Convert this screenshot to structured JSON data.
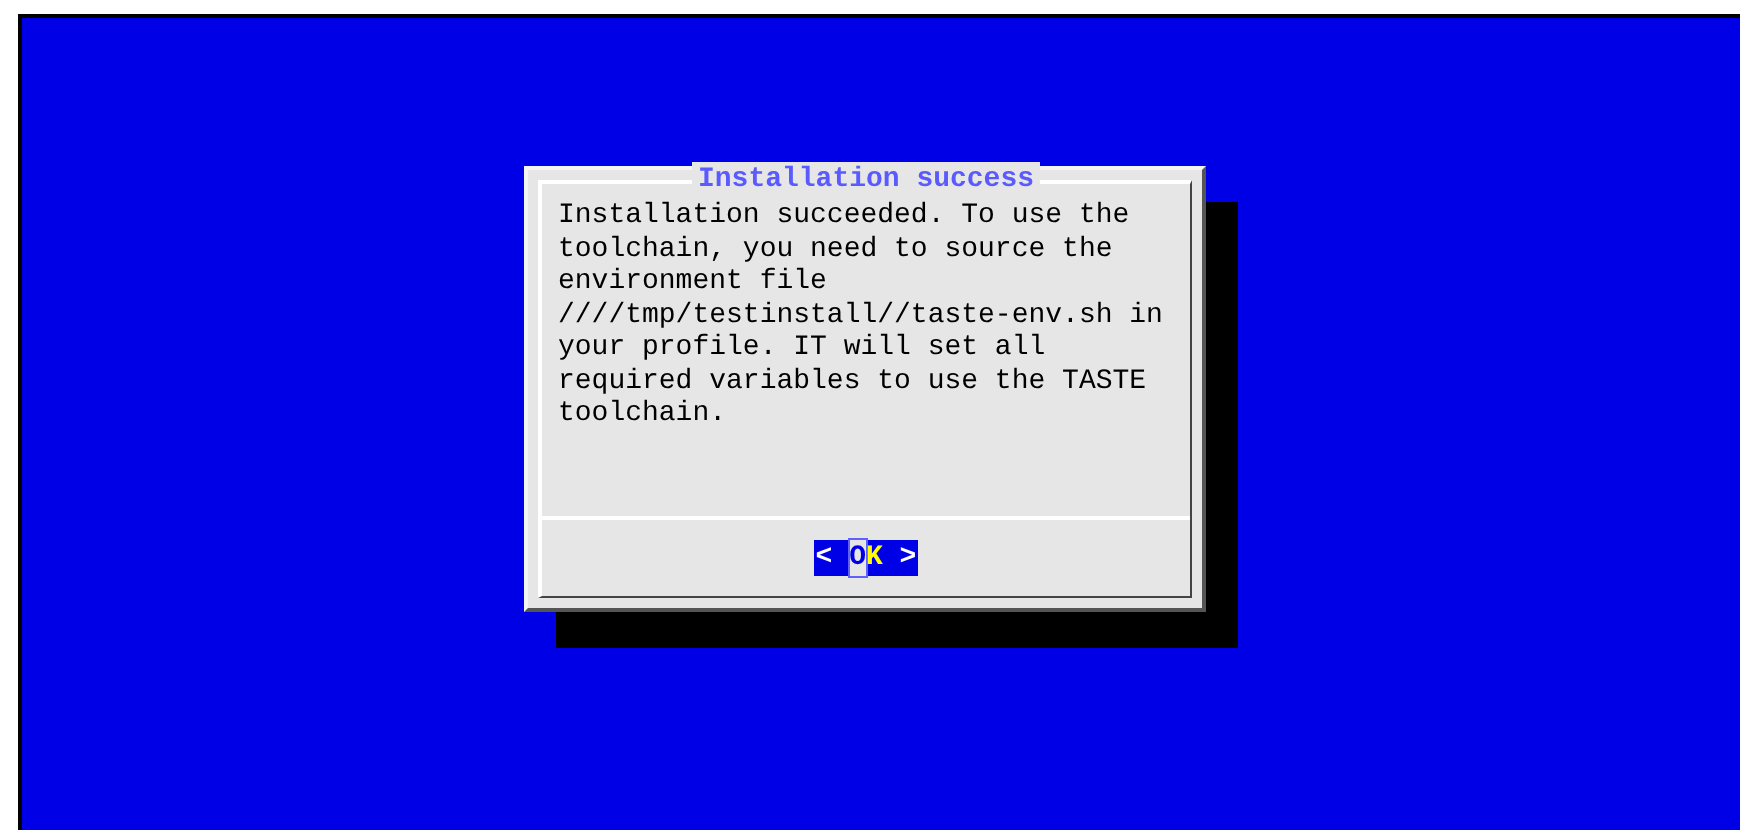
{
  "dialog": {
    "title": "Installation success",
    "lines": [
      "Installation succeeded. To use the",
      "toolchain, you need to source the",
      "environment file",
      "////tmp/testinstall//taste-env.sh in",
      "your profile. IT will set all",
      "required variables to use the TASTE",
      "toolchain."
    ],
    "buttons": [
      {
        "left_mark": "<",
        "label": "OK",
        "right_mark": ">",
        "selected": true
      }
    ]
  }
}
